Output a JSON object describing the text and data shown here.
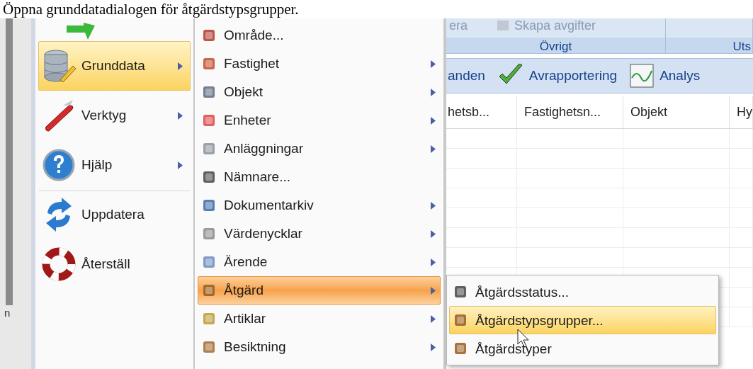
{
  "caption": "Öppna grunddatadialogen för åtgärdstypsgrupper.",
  "left_edge_text": "n",
  "main_menu": [
    {
      "label": "Grunddata",
      "has_submenu": true,
      "selected": true,
      "separator_before": false
    },
    {
      "label": "Verktyg",
      "has_submenu": true,
      "selected": false,
      "separator_before": false
    },
    {
      "label": "Hjälp",
      "has_submenu": true,
      "selected": false,
      "separator_before": false
    },
    {
      "label": "Uppdatera",
      "has_submenu": false,
      "selected": false,
      "separator_before": true
    },
    {
      "label": "Återställ",
      "has_submenu": false,
      "selected": false,
      "separator_before": false
    }
  ],
  "submenu": [
    {
      "label": "Område...",
      "has_submenu": false,
      "selected": false
    },
    {
      "label": "Fastighet",
      "has_submenu": true,
      "selected": false
    },
    {
      "label": "Objekt",
      "has_submenu": true,
      "selected": false
    },
    {
      "label": "Enheter",
      "has_submenu": true,
      "selected": false
    },
    {
      "label": "Anläggningar",
      "has_submenu": true,
      "selected": false
    },
    {
      "label": "Nämnare...",
      "has_submenu": false,
      "selected": false
    },
    {
      "label": "Dokumentarkiv",
      "has_submenu": true,
      "selected": false
    },
    {
      "label": "Värdenycklar",
      "has_submenu": true,
      "selected": false
    },
    {
      "label": "Ärende",
      "has_submenu": true,
      "selected": false
    },
    {
      "label": "Åtgärd",
      "has_submenu": true,
      "selected": true
    },
    {
      "label": "Artiklar",
      "has_submenu": true,
      "selected": false
    },
    {
      "label": "Besiktning",
      "has_submenu": true,
      "selected": false
    }
  ],
  "submenu_2": [
    {
      "label": "Åtgärdsstatus...",
      "selected": false
    },
    {
      "label": "Åtgärdstypsgrupper...",
      "selected": true
    },
    {
      "label": "Åtgärdstyper",
      "selected": false
    }
  ],
  "ribbon": [
    {
      "label": "Övrigt",
      "buttons": [
        {
          "label": "era",
          "disabled": true
        },
        {
          "label": "Skapa avgifter",
          "disabled": true
        }
      ]
    },
    {
      "label": "Uts"
    }
  ],
  "toolbar": [
    "anden",
    "Avrapportering",
    "Analys"
  ],
  "grid": {
    "columns": [
      "hetsb...",
      "Fastighetsn...",
      "Objekt",
      "Hy"
    ]
  }
}
